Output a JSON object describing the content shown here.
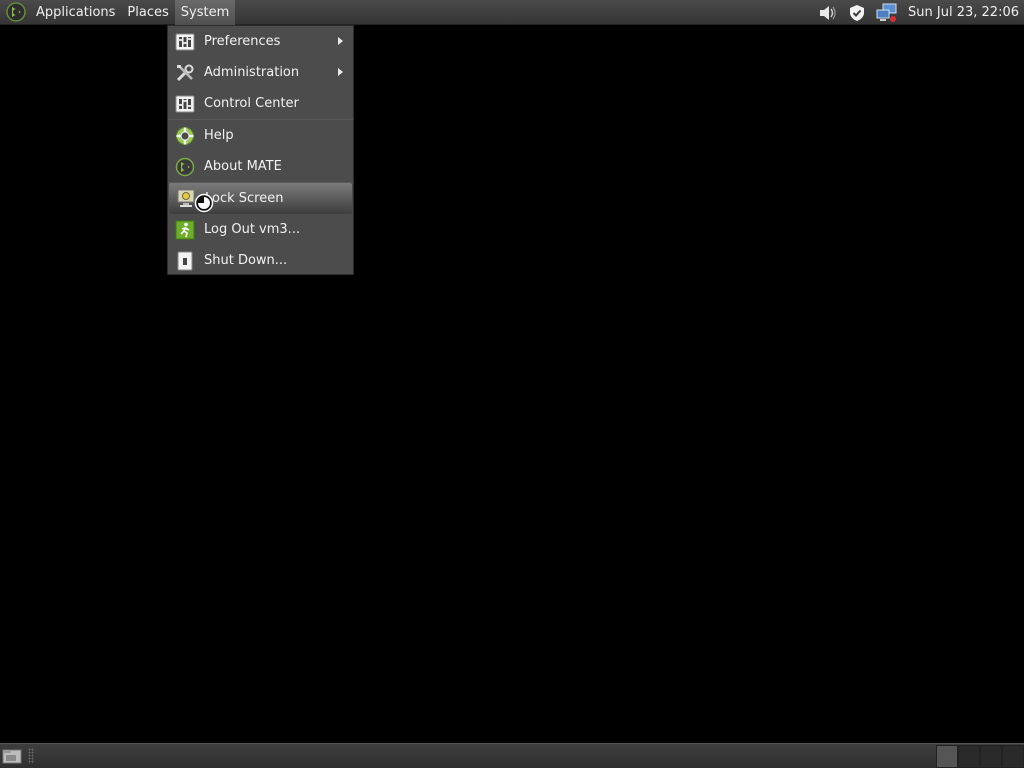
{
  "top_panel": {
    "menus": [
      "Applications",
      "Places",
      "System"
    ],
    "clock": "Sun Jul 23, 22:06",
    "tray_icons": [
      "volume-icon",
      "shield-update-icon",
      "network-icon"
    ]
  },
  "system_menu": {
    "items": [
      {
        "label": "Preferences",
        "icon": "preferences-icon",
        "submenu": true
      },
      {
        "label": "Administration",
        "icon": "administration-icon",
        "submenu": true
      },
      {
        "label": "Control Center",
        "icon": "control-center-icon",
        "submenu": false
      },
      {
        "label": "Help",
        "icon": "help-lifebuoy-icon",
        "submenu": false
      },
      {
        "label": "About MATE",
        "icon": "mate-logo-icon",
        "submenu": false
      },
      {
        "label": "Lock Screen",
        "icon": "lock-screen-icon",
        "submenu": false
      },
      {
        "label": "Log Out vm3...",
        "icon": "log-out-icon",
        "submenu": false
      },
      {
        "label": "Shut Down...",
        "icon": "shut-down-icon",
        "submenu": false
      }
    ],
    "highlighted": "Lock Screen"
  },
  "colors": {
    "panel": "#3d3d3d",
    "menu_bg": "#4c4c4c",
    "desktop": "#000000",
    "mate_green": "#8ab84a"
  }
}
